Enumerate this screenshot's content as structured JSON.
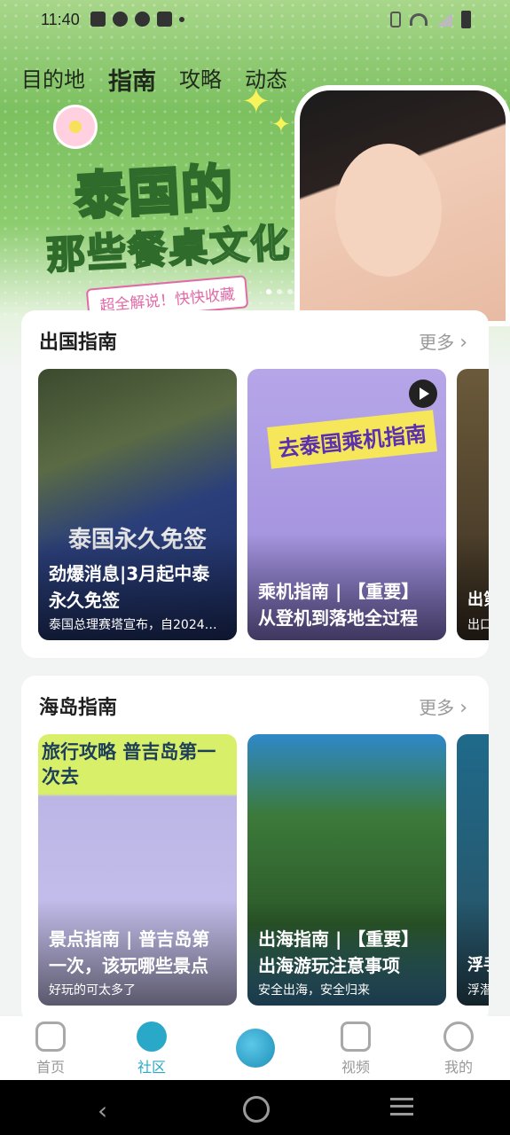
{
  "status_bar": {
    "time": "11:40"
  },
  "top_tabs": [
    {
      "label": "目的地",
      "active": false
    },
    {
      "label": "指南",
      "active": true
    },
    {
      "label": "攻略",
      "active": false
    },
    {
      "label": "动态",
      "active": false
    }
  ],
  "banner": {
    "title_line1": "泰国的",
    "title_line2": "那些餐桌文化",
    "subtitle": "超全解说！快快收藏"
  },
  "sections": [
    {
      "title": "出国指南",
      "more": "更多",
      "cards": [
        {
          "overlay": "泰国永久免签",
          "title": "劲爆消息|3月起中泰永久免签",
          "desc": "泰国总理赛塔宣布，自2024…"
        },
        {
          "overlay": "去泰国乘机指南",
          "title": "乘机指南 | 【重要】从登机到落地全过程",
          "desc": ""
        },
        {
          "overlay": "",
          "title": "出第",
          "desc": "出口"
        }
      ]
    },
    {
      "title": "海岛指南",
      "more": "更多",
      "cards": [
        {
          "overlay": "旅行攻略 普吉岛第一次去",
          "title": "景点指南 | 普吉岛第一次，该玩哪些景点",
          "desc": "好玩的可太多了"
        },
        {
          "overlay": "",
          "title": "出海指南 | 【重要】出海游玩注意事项",
          "desc": "安全出海，安全归来"
        },
        {
          "overlay": "",
          "title": "浮手",
          "desc": "浮潜"
        }
      ]
    }
  ],
  "bottom_nav": [
    {
      "label": "首页",
      "icon": "home-icon",
      "active": false
    },
    {
      "label": "社区",
      "icon": "community-icon",
      "active": true
    },
    {
      "label": "",
      "icon": "globe-icon",
      "active": false
    },
    {
      "label": "视频",
      "icon": "video-icon",
      "active": false
    },
    {
      "label": "我的",
      "icon": "profile-icon",
      "active": false
    }
  ],
  "colors": {
    "accent": "#2aa8c8",
    "banner_green": "#7cc060"
  }
}
